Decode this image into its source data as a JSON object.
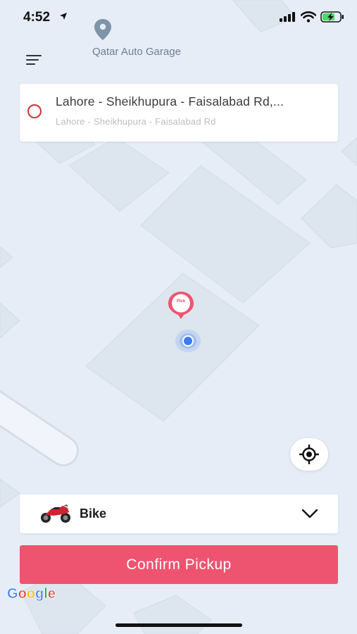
{
  "status_bar": {
    "time": "4:52"
  },
  "map": {
    "poi_label": "Qatar Auto Garage",
    "pick_marker_label": "Pick",
    "colors": {
      "background": "#e6edf6",
      "block": "#dde5ef",
      "road": "#f1f5fb",
      "accent": "#ee5470",
      "location_dot": "#3d7bf0"
    }
  },
  "address": {
    "main": "Lahore - Sheikhupura - Faisalabad Rd,...",
    "sub": "Lahore - Sheikhupura - Faisalabad Rd"
  },
  "vehicle": {
    "selected": "Bike",
    "icon": "motorbike-icon"
  },
  "actions": {
    "confirm_label": "Confirm Pickup"
  },
  "attribution": {
    "google": "Google"
  }
}
